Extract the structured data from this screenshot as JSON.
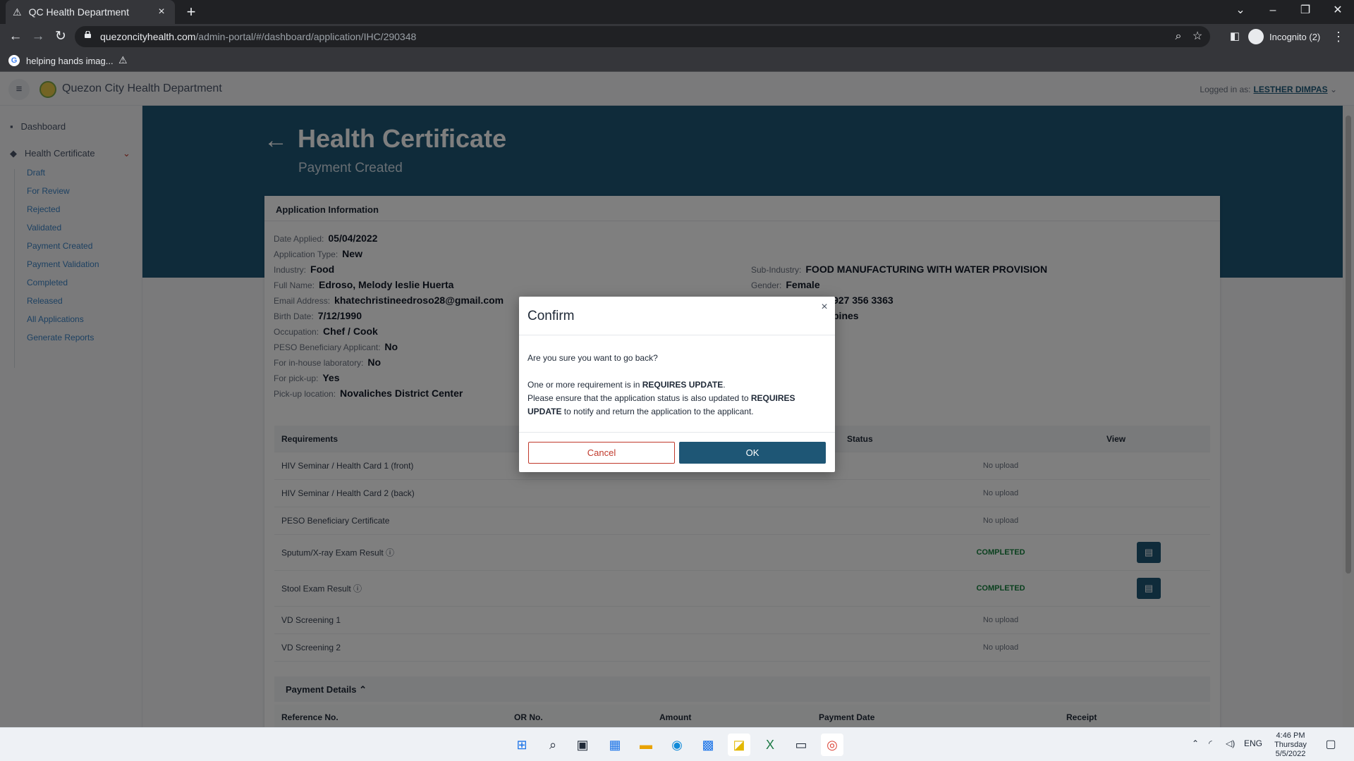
{
  "browser": {
    "tab_title": "QC Health Department",
    "tab_close": "×",
    "new_tab": "+",
    "url_host": "quezoncityhealth.com",
    "url_path": "/admin-portal/#/dashboard/application/IHC/290348",
    "profile_label": "Incognito (2)",
    "bookmark_label": "helping hands imag..."
  },
  "app": {
    "brand": "Quezon City Health Department",
    "logged_in_label": "Logged in as:",
    "logged_in_user": "LESTHER DIMPAS"
  },
  "sidebar": {
    "dashboard": "Dashboard",
    "health_certificate": "Health Certificate",
    "items": [
      "Draft",
      "For Review",
      "Rejected",
      "Validated",
      "Payment Created",
      "Payment Validation",
      "Completed",
      "Released",
      "All Applications",
      "Generate Reports"
    ]
  },
  "hero": {
    "title": "Health Certificate",
    "subtitle": "Payment Created"
  },
  "application": {
    "section_title": "Application Information",
    "fields_left": [
      {
        "label": "Date Applied:",
        "value": "05/04/2022"
      },
      {
        "label": "Application Type:",
        "value": "New"
      },
      {
        "label": "Industry:",
        "value": "Food"
      },
      {
        "label": "Full Name:",
        "value": "Edroso, Melody leslie Huerta"
      },
      {
        "label": "Email Address:",
        "value": "khatechristineedroso28@gmail.com"
      },
      {
        "label": "Birth Date:",
        "value": "7/12/1990"
      },
      {
        "label": "Occupation:",
        "value": "Chef / Cook"
      },
      {
        "label": "PESO Beneficiary Applicant:",
        "value": "No"
      },
      {
        "label": "For in-house laboratory:",
        "value": "No"
      },
      {
        "label": "For pick-up:",
        "value": "Yes"
      },
      {
        "label": "Pick-up location:",
        "value": "Novaliches District Center"
      }
    ],
    "fields_right": [
      {
        "label": "Sub-Industry:",
        "value": "FOOD MANUFACTURING WITH WATER PROVISION"
      },
      {
        "label": "Gender:",
        "value": "Female"
      },
      {
        "label": "",
        "value": "927 356 3363"
      },
      {
        "label": "",
        "value": "pines"
      }
    ]
  },
  "requirements": {
    "headers": {
      "name": "Requirements",
      "status": "Status",
      "view": "View"
    },
    "rows": [
      {
        "name": "HIV Seminar / Health Card 1 (front)",
        "status": "No upload",
        "done": false
      },
      {
        "name": "HIV Seminar / Health Card 2 (back)",
        "status": "No upload",
        "done": false
      },
      {
        "name": "PESO Beneficiary Certificate",
        "status": "No upload",
        "done": false
      },
      {
        "name": "Sputum/X-ray Exam Result ⓘ",
        "status": "COMPLETED",
        "done": true
      },
      {
        "name": "Stool Exam Result ⓘ",
        "status": "COMPLETED",
        "done": true
      },
      {
        "name": "VD Screening 1",
        "status": "No upload",
        "done": false
      },
      {
        "name": "VD Screening 2",
        "status": "No upload",
        "done": false
      }
    ]
  },
  "payment": {
    "title": "Payment Details",
    "columns": [
      "Reference No.",
      "OR No.",
      "Amount",
      "Payment Date",
      "Receipt"
    ]
  },
  "modal": {
    "title": "Confirm",
    "close": "×",
    "line1": "Are you sure you want to go back?",
    "line2_a": "One or more requirement is in ",
    "line2_b": "REQUIRES UPDATE",
    "line2_c": ".",
    "line3_a": "Please ensure that the application status is also updated to ",
    "line3_b": "REQUIRES UPDATE",
    "line3_c": " to notify and return the application to the applicant.",
    "cancel": "Cancel",
    "ok": "OK"
  },
  "taskbar": {
    "lang": "ENG",
    "time": "4:46 PM",
    "day": "Thursday",
    "date": "5/5/2022"
  },
  "colors": {
    "primary": "#1e5675",
    "cancel": "#c0392b",
    "completed": "#15803d"
  }
}
